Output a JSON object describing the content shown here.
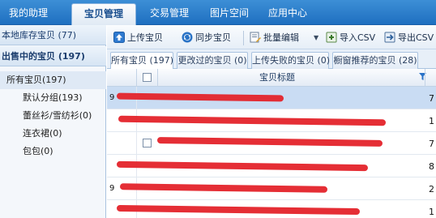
{
  "topnav": {
    "tabs": [
      {
        "label": "我的助理",
        "active": false
      },
      {
        "label": "宝贝管理",
        "active": true
      },
      {
        "label": "交易管理",
        "active": false
      },
      {
        "label": "图片空间",
        "active": false
      },
      {
        "label": "应用中心",
        "active": false
      }
    ]
  },
  "sidebar": {
    "local_header": "本地库存宝贝 (77)",
    "selling_header": "出售中的宝贝 (197)",
    "tree": {
      "root": "所有宝贝(197)",
      "children": [
        "默认分组(193)",
        "蕾丝衫/雪纺衫(0)",
        "连衣裙(0)",
        "包包(0)"
      ]
    }
  },
  "toolbar": {
    "upload": "上传宝贝",
    "sync": "同步宝贝",
    "batch_edit": "批量编辑",
    "import_csv": "导入CSV",
    "export_csv": "导出CSV"
  },
  "subtabs": [
    {
      "label": "所有宝贝 (197)",
      "active": true
    },
    {
      "label": "更改过的宝贝 (0)",
      "active": false
    },
    {
      "label": "上传失败的宝贝 (0)",
      "active": false
    },
    {
      "label": "橱窗推荐的宝贝 (28)",
      "active": false
    }
  ],
  "grid": {
    "column_title": "宝贝标题",
    "rows": [
      {
        "end": "7",
        "selected": true
      },
      {
        "end": "1",
        "selected": false
      },
      {
        "end": "7",
        "selected": false
      },
      {
        "end": "8",
        "selected": false
      },
      {
        "end": "2",
        "selected": false
      },
      {
        "end": "1",
        "selected": false
      }
    ]
  },
  "colors": {
    "nav_blue": "#2a7fd0",
    "redaction": "#e4232a",
    "selected_row": "#c9dcf3"
  }
}
